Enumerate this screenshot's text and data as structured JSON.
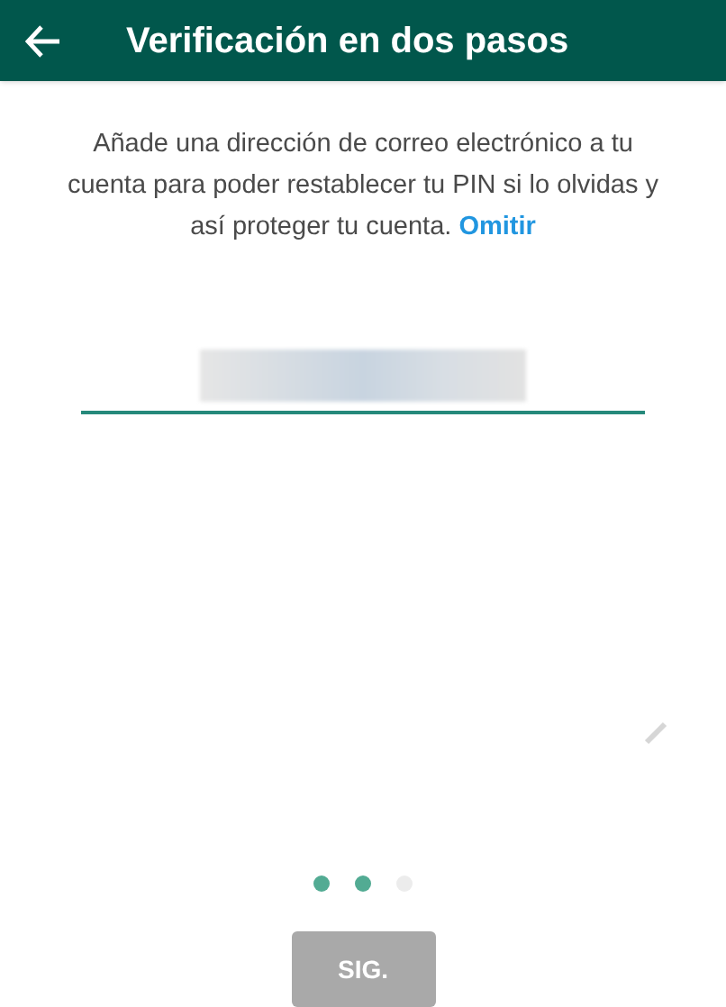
{
  "app_bar": {
    "title": "Verificación en dos pasos"
  },
  "message": {
    "text": "Añade una dirección de correo electrónico a tu cuenta para poder restablecer tu PIN si lo olvidas y así proteger tu cuenta.",
    "link": "Omitir"
  },
  "email_field": {
    "focused": true
  },
  "page_dots": [
    {
      "filled": true
    },
    {
      "filled": true
    },
    {
      "filled": false
    }
  ],
  "next_button": {
    "label": "SIG.",
    "disabled": true
  }
}
